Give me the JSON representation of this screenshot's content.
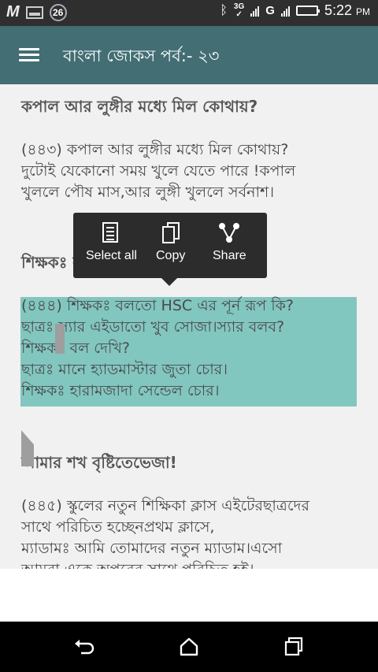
{
  "status_bar": {
    "notification_count": "26",
    "network_3g": "3G",
    "network_g": "G",
    "time": "5:22",
    "ampm": "PM"
  },
  "app_bar": {
    "title": "বাংলা জোকস পর্ব:- ২৩"
  },
  "content": {
    "section1": {
      "heading": "কপাল আর লুঙ্গীর মধ্যে মিল কোথায়?",
      "lines": [
        "(৪৪৩) কপাল আর লুঙ্গীর মধ্যে মিল কোথায়?",
        "দুটোই যেকোনো সময় খুলে যেতে পারে !কপাল",
        "খুললে পৌষ মাস,আর লুঙ্গী খুললে সর্বনাশ।"
      ]
    },
    "section2": {
      "heading": "শিক্ষকঃ বলতো HSC এর পূর্ন রূপ কি?",
      "lines": [
        "(৪৪৪) শিক্ষকঃ বলতো HSC এর পূর্ন রূপ কি?",
        "ছাত্রঃ স্যার এইডাতো খুব সোজা।স্যার বলব?",
        "শিক্ষকঃ বল দেখি?",
        "ছাত্রঃ মানে হ্যাডমাস্টার জুতা চোর।",
        "শিক্ষকঃ হারামজাদা সেন্ডেল চোর।"
      ]
    },
    "section3": {
      "heading": "আমার শখ বৃষ্টিতেভেজা!",
      "lines": [
        "(৪৪৫) স্কুলের নতুন শিক্ষিকা ক্লাস এইটেরছাত্রদের",
        "সাথে পরিচিত হচ্ছেনপ্রথম ক্লাসে,",
        "ম্যাডামঃ আমি তোমাদের নতুন ম্যাডাম।এসো",
        "আমরা একে অপরের সাথে পরিচিত হই।"
      ]
    }
  },
  "context_menu": {
    "select_all": "Select all",
    "copy": "Copy",
    "share": "Share"
  },
  "icons": {
    "menu": "hamburger-menu-icon",
    "select_all": "document-icon",
    "copy": "copy-icon",
    "share": "share-icon",
    "back": "back-icon",
    "home": "home-icon",
    "recents": "recents-icon"
  },
  "colors": {
    "app_bar": "#426e74",
    "selection": "#82c6c0",
    "popup": "#2c2c2c"
  }
}
